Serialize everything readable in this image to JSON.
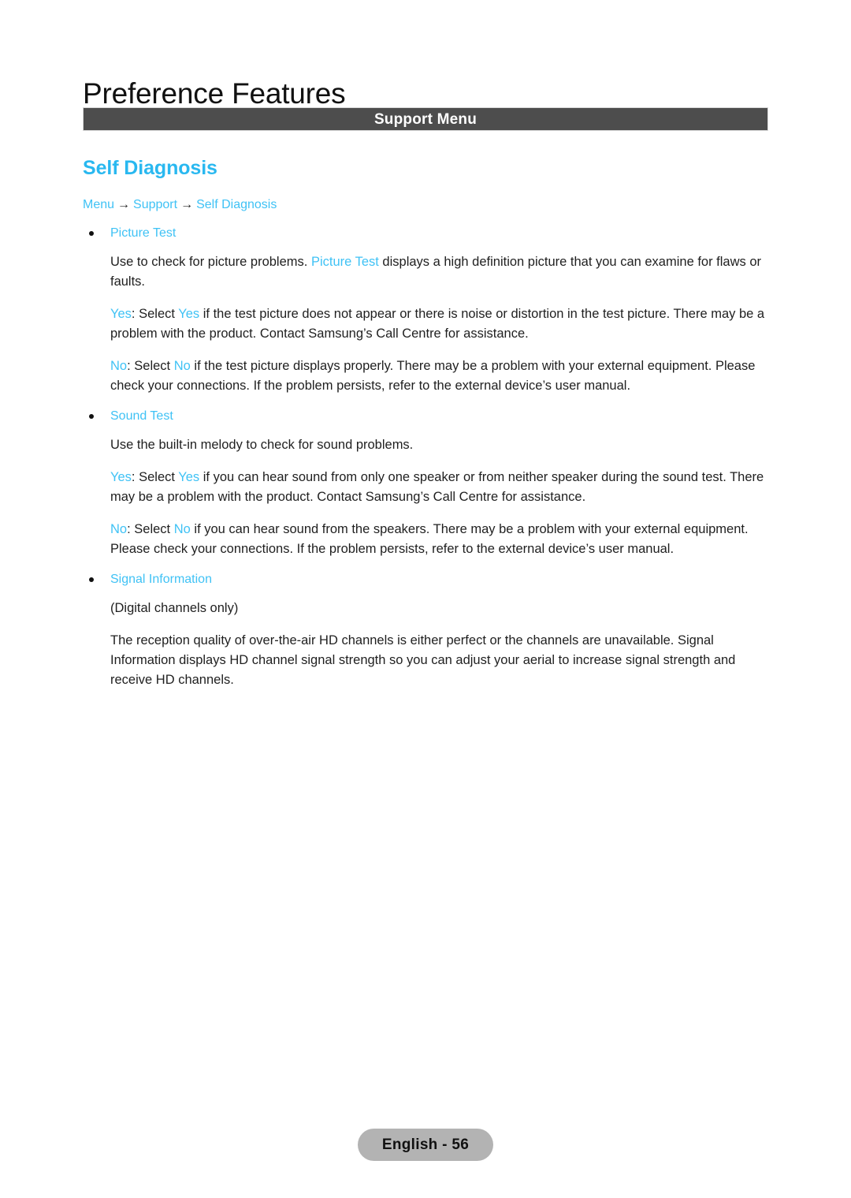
{
  "page": {
    "chapter_title": "Preference Features",
    "section_bar_label": "Support Menu",
    "topic_heading": "Self Diagnosis"
  },
  "breadcrumb": {
    "items": [
      "Menu",
      "Support",
      "Self Diagnosis"
    ],
    "separator": "→"
  },
  "sections": [
    {
      "bullet_label": "Picture Test",
      "paragraphs": [
        {
          "runs": [
            {
              "text": "Use to check for picture problems. ",
              "accent": false
            },
            {
              "text": "Picture Test",
              "accent": true
            },
            {
              "text": " displays a high definition picture that you can examine for flaws or faults.",
              "accent": false
            }
          ]
        },
        {
          "runs": [
            {
              "text": "Yes",
              "accent": true
            },
            {
              "text": ": Select ",
              "accent": false
            },
            {
              "text": "Yes",
              "accent": true
            },
            {
              "text": " if the test picture does not appear or there is noise or distortion in the test picture. There may be a problem with the product. Contact Samsung’s Call Centre for assistance.",
              "accent": false
            }
          ]
        },
        {
          "runs": [
            {
              "text": "No",
              "accent": true
            },
            {
              "text": ": Select ",
              "accent": false
            },
            {
              "text": "No",
              "accent": true
            },
            {
              "text": " if the test picture displays properly. There may be a problem with your external equipment. Please check your connections. If the problem persists, refer to the external device’s user manual.",
              "accent": false
            }
          ]
        }
      ]
    },
    {
      "bullet_label": "Sound Test",
      "paragraphs": [
        {
          "runs": [
            {
              "text": "Use the built-in melody to check for sound problems.",
              "accent": false
            }
          ]
        },
        {
          "runs": [
            {
              "text": "Yes",
              "accent": true
            },
            {
              "text": ": Select ",
              "accent": false
            },
            {
              "text": "Yes",
              "accent": true
            },
            {
              "text": " if you can hear sound from only one speaker or from neither speaker during the sound test. There may be a problem with the product. Contact Samsung’s Call Centre for assistance.",
              "accent": false
            }
          ]
        },
        {
          "runs": [
            {
              "text": "No",
              "accent": true
            },
            {
              "text": ": Select ",
              "accent": false
            },
            {
              "text": "No",
              "accent": true
            },
            {
              "text": " if you can hear sound from the speakers. There may be a problem with your external equipment. Please check your connections. If the problem persists, refer to the external device’s user manual.",
              "accent": false
            }
          ]
        }
      ]
    },
    {
      "bullet_label": "Signal Information",
      "paragraphs": [
        {
          "runs": [
            {
              "text": "(Digital channels only)",
              "accent": false
            }
          ]
        },
        {
          "runs": [
            {
              "text": "The reception quality of over-the-air HD channels is either perfect or the channels are unavailable. Signal Information displays HD channel signal strength so you can adjust your aerial to increase signal strength and receive HD channels.",
              "accent": false
            }
          ]
        }
      ]
    }
  ],
  "footer": {
    "page_label": "English - 56"
  },
  "colors": {
    "accent": "#3fc2f5",
    "heading_accent": "#29b8f0",
    "bar_background": "#4d4d4d",
    "footer_badge_background": "#b3b3b3",
    "body_text": "#1f1f1f"
  }
}
